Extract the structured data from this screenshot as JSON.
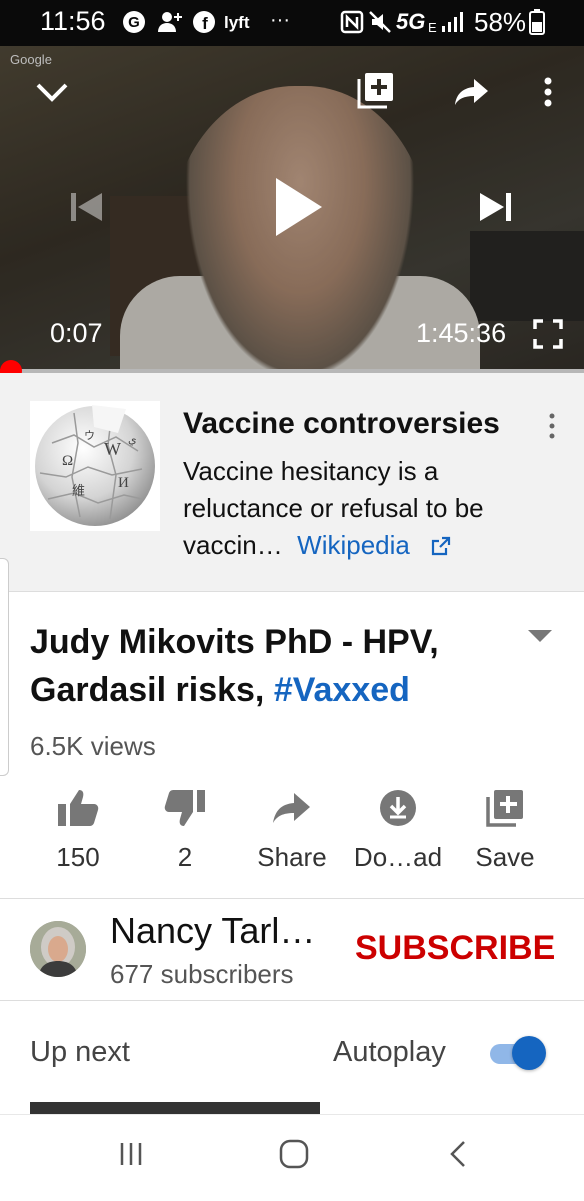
{
  "status_bar": {
    "time": "11:56",
    "network": "5G",
    "network_sub": "E",
    "battery": "58%",
    "more": "···"
  },
  "player": {
    "watermark": "Google",
    "current_time": "0:07",
    "duration": "1:45:36",
    "progress": 0.001,
    "accent": "#ff0000",
    "icons": [
      "chevron-down-icon",
      "add-to-queue-icon",
      "share-icon",
      "more-vert-icon",
      "skip-previous-icon",
      "play-icon",
      "skip-next-icon",
      "fullscreen-icon"
    ]
  },
  "info_card": {
    "title": "Vaccine controversies",
    "description": "Vaccine hesitancy is a reluctance or refusal to be vaccin…",
    "link_label": "Wikipedia",
    "link_color": "#1565c0"
  },
  "video": {
    "title_main": "Judy Mikovits PhD - HPV, Gardasil risks, ",
    "title_hashtag": "#Vaxxed",
    "views": "6.5K views"
  },
  "actions": {
    "like_count": "150",
    "dislike_count": "2",
    "share_label": "Share",
    "download_label": "Do…ad",
    "save_label": "Save"
  },
  "channel": {
    "name": "Nancy Tarl…",
    "subscribers": "677 subscribers",
    "subscribe_label": "SUBSCRIBE",
    "subscribe_color": "#cc0000"
  },
  "up_next": {
    "label": "Up next",
    "autoplay_label": "Autoplay",
    "autoplay_on": true
  }
}
